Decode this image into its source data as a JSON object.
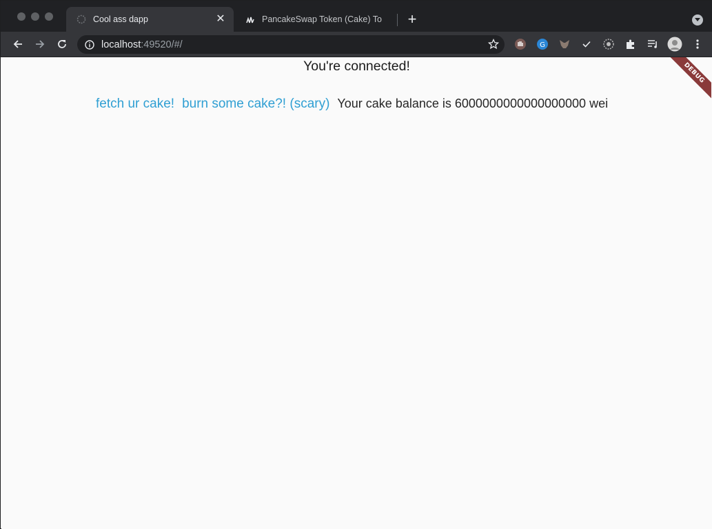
{
  "browser": {
    "tabs": [
      {
        "title": "Cool ass dapp",
        "active": true,
        "favicon": "spinner-icon"
      },
      {
        "title": "PancakeSwap Token (Cake) To",
        "active": false,
        "favicon": "bscscan-icon"
      }
    ],
    "new_tab_label": "+",
    "url": {
      "host": "localhost",
      "rest": ":49520/#/"
    },
    "extensions": [
      "hand-icon",
      "grammarly-icon",
      "metamask-icon",
      "checkmark-icon",
      "gear-icon",
      "puzzle-icon",
      "playlist-icon",
      "avatar",
      "menu-icon"
    ]
  },
  "page": {
    "heading": "You're connected!",
    "fetch_label": "fetch ur cake!",
    "burn_label": "burn some cake?! (scary)",
    "balance_text": "Your cake balance is 6000000000000000000 wei",
    "debug_banner": "DEBUG"
  },
  "colors": {
    "link": "#2f9fd3",
    "page_bg": "#fafafa",
    "toolbar_bg": "#35363a",
    "tabstrip_bg": "#202124",
    "debug_ribbon": "#8a3a3a"
  }
}
